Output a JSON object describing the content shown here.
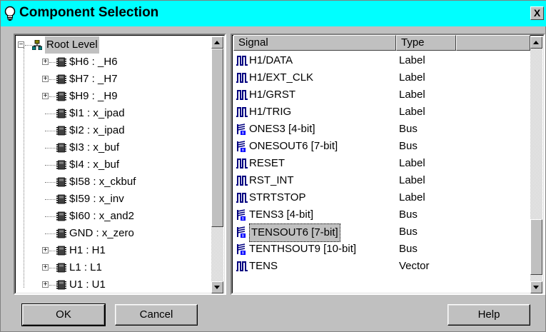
{
  "window": {
    "title": "Component Selection",
    "close_label": "X"
  },
  "tree": {
    "items": [
      {
        "label": "Root Level",
        "level": 0,
        "expander": "minus",
        "icon": "hierarchy-icon"
      },
      {
        "label": "$H6 : _H6",
        "level": 1,
        "expander": "plus",
        "icon": "chip-icon"
      },
      {
        "label": "$H7 : _H7",
        "level": 1,
        "expander": "plus",
        "icon": "chip-icon"
      },
      {
        "label": "$H9 : _H9",
        "level": 1,
        "expander": "plus",
        "icon": "chip-icon"
      },
      {
        "label": "$I1 : x_ipad",
        "level": 1,
        "expander": "none",
        "icon": "chip-icon"
      },
      {
        "label": "$I2 : x_ipad",
        "level": 1,
        "expander": "none",
        "icon": "chip-icon"
      },
      {
        "label": "$I3 : x_buf",
        "level": 1,
        "expander": "none",
        "icon": "chip-icon"
      },
      {
        "label": "$I4 : x_buf",
        "level": 1,
        "expander": "none",
        "icon": "chip-icon"
      },
      {
        "label": "$I58 : x_ckbuf",
        "level": 1,
        "expander": "none",
        "icon": "chip-icon"
      },
      {
        "label": "$I59 : x_inv",
        "level": 1,
        "expander": "none",
        "icon": "chip-icon"
      },
      {
        "label": "$I60 : x_and2",
        "level": 1,
        "expander": "none",
        "icon": "chip-icon"
      },
      {
        "label": "GND : x_zero",
        "level": 1,
        "expander": "none",
        "icon": "chip-icon"
      },
      {
        "label": "H1 : H1",
        "level": 1,
        "expander": "plus",
        "icon": "chip-icon"
      },
      {
        "label": "L1 : L1",
        "level": 1,
        "expander": "plus",
        "icon": "chip-icon"
      },
      {
        "label": "U1 : U1",
        "level": 1,
        "expander": "plus",
        "icon": "chip-icon"
      }
    ]
  },
  "signals": {
    "headers": [
      "Signal",
      "Type",
      ""
    ],
    "rows": [
      {
        "signal": "H1/DATA",
        "type": "Label",
        "icon": "pulse-icon"
      },
      {
        "signal": "H1/EXT_CLK",
        "type": "Label",
        "icon": "pulse-icon"
      },
      {
        "signal": "H1/GRST",
        "type": "Label",
        "icon": "pulse-icon"
      },
      {
        "signal": "H1/TRIG",
        "type": "Label",
        "icon": "pulse-icon"
      },
      {
        "signal": "ONES3 [4-bit]",
        "type": "Bus",
        "icon": "bus-icon"
      },
      {
        "signal": "ONESOUT6 [7-bit]",
        "type": "Bus",
        "icon": "bus-icon"
      },
      {
        "signal": "RESET",
        "type": "Label",
        "icon": "pulse-icon"
      },
      {
        "signal": "RST_INT",
        "type": "Label",
        "icon": "pulse-icon"
      },
      {
        "signal": "STRTSTOP",
        "type": "Label",
        "icon": "pulse-icon"
      },
      {
        "signal": "TENS3 [4-bit]",
        "type": "Bus",
        "icon": "bus-icon"
      },
      {
        "signal": "TENSOUT6 [7-bit]",
        "type": "Bus",
        "icon": "bus-icon",
        "selected": true
      },
      {
        "signal": "TENTHSOUT9 [10-bit]",
        "type": "Bus",
        "icon": "bus-icon"
      },
      {
        "signal": "TENS",
        "type": "Vector",
        "icon": "pulse-icon"
      }
    ]
  },
  "buttons": {
    "ok": "OK",
    "cancel": "Cancel",
    "help": "Help"
  }
}
